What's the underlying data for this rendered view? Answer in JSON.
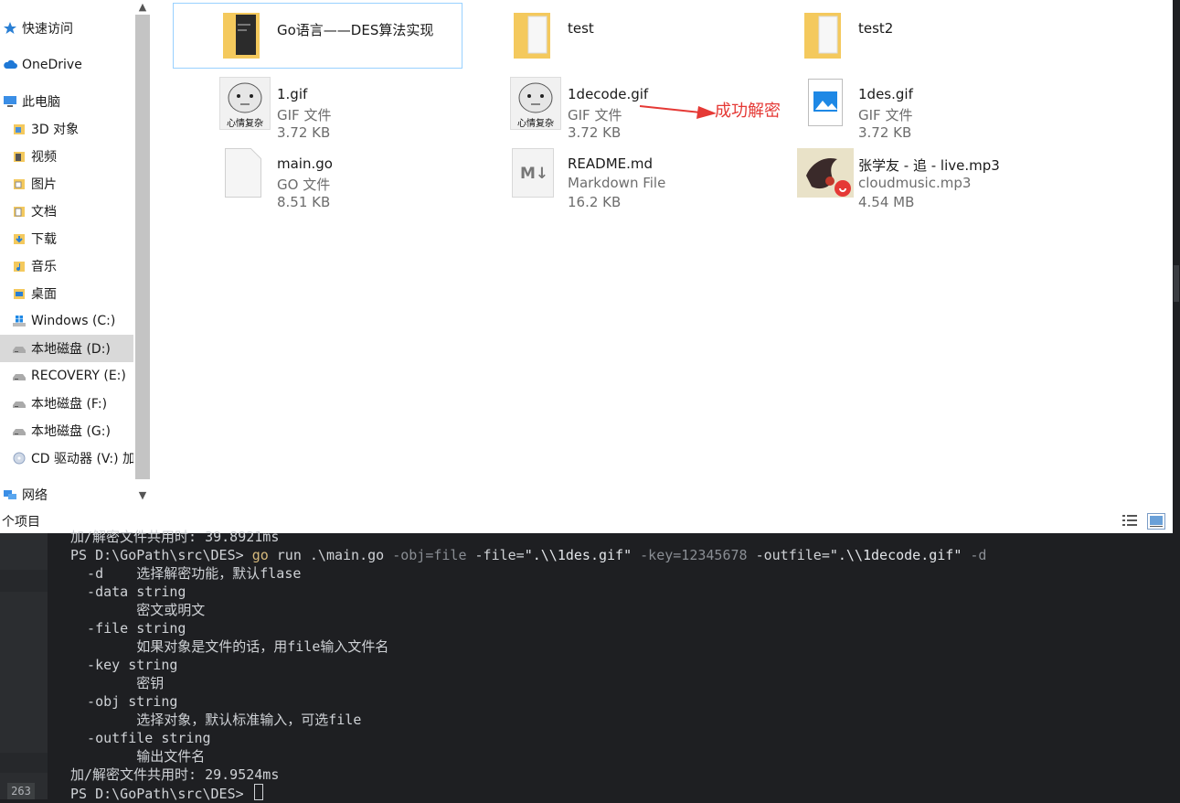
{
  "nav": {
    "items": [
      {
        "label": "快速访问",
        "icon": "star-icon"
      },
      {
        "label": "OneDrive",
        "icon": "cloud-icon"
      },
      {
        "label": "此电脑",
        "icon": "computer-icon"
      },
      {
        "label": "3D 对象",
        "icon": "cube-folder-icon"
      },
      {
        "label": "视频",
        "icon": "video-folder-icon"
      },
      {
        "label": "图片",
        "icon": "picture-folder-icon"
      },
      {
        "label": "文档",
        "icon": "document-folder-icon"
      },
      {
        "label": "下载",
        "icon": "download-folder-icon"
      },
      {
        "label": "音乐",
        "icon": "music-folder-icon"
      },
      {
        "label": "桌面",
        "icon": "desktop-folder-icon"
      },
      {
        "label": "Windows (C:)",
        "icon": "windows-drive-icon"
      },
      {
        "label": "本地磁盘 (D:)",
        "icon": "drive-icon"
      },
      {
        "label": "RECOVERY (E:)",
        "icon": "drive-icon"
      },
      {
        "label": "本地磁盘 (F:)",
        "icon": "drive-icon"
      },
      {
        "label": "本地磁盘 (G:)",
        "icon": "drive-icon"
      },
      {
        "label": "CD 驱动器 (V:) 加",
        "icon": "cd-drive-icon"
      },
      {
        "label": "网络",
        "icon": "network-icon"
      }
    ]
  },
  "files": [
    {
      "name": "Go语言——DES算法实现",
      "type": "",
      "size": "",
      "kind": "folder-dark"
    },
    {
      "name": "test",
      "type": "",
      "size": "",
      "kind": "folder"
    },
    {
      "name": "test2",
      "type": "",
      "size": "",
      "kind": "folder"
    },
    {
      "name": "1.gif",
      "type": "GIF 文件",
      "size": "3.72 KB",
      "kind": "meme"
    },
    {
      "name": "1decode.gif",
      "type": "GIF 文件",
      "size": "3.72 KB",
      "kind": "meme"
    },
    {
      "name": "1des.gif",
      "type": "GIF 文件",
      "size": "3.72 KB",
      "kind": "image-broken"
    },
    {
      "name": "main.go",
      "type": "GO 文件",
      "size": "8.51 KB",
      "kind": "blank"
    },
    {
      "name": "README.md",
      "type": "Markdown File",
      "size": "16.2 KB",
      "kind": "markdown"
    },
    {
      "name": "张学友 - 追 - live.mp3",
      "type": "cloudmusic.mp3",
      "size": "4.54 MB",
      "kind": "music"
    }
  ],
  "meme_caption": "心情复杂",
  "annotation": "成功解密",
  "status": {
    "text": "个项目"
  },
  "terminal": {
    "line_number": "263",
    "lines": [
      {
        "text": "加/解密文件共用时: 39.8921ms"
      },
      {
        "prompt": "PS D:\\GoPath\\src\\DES> ",
        "cmd": "go",
        "rest1": " run .\\main.go ",
        "a1": "-obj=file",
        "rest2": " -file=",
        "s1": "\".\\\\1des.gif\"",
        "a2": " -key=12345678",
        "rest3": " -outfile=",
        "s2": "\".\\\\1decode.gif\"",
        "a3": " -d"
      },
      {
        "text": "  -d    选择解密功能，默认flase"
      },
      {
        "text": "  -data string"
      },
      {
        "text": "        密文或明文"
      },
      {
        "text": "  -file string"
      },
      {
        "text": "        如果对象是文件的话，用file输入文件名"
      },
      {
        "text": "  -key string"
      },
      {
        "text": "        密钥"
      },
      {
        "text": "  -obj string"
      },
      {
        "text": "        选择对象，默认标准输入，可选file"
      },
      {
        "text": "  -outfile string"
      },
      {
        "text": "        输出文件名"
      },
      {
        "text": "加/解密文件共用时: 29.9524ms"
      },
      {
        "text": "PS D:\\GoPath\\src\\DES> "
      }
    ]
  },
  "colors": {
    "annotation": "#e53935",
    "folder": "#f4c95d",
    "accent": "#0078d7",
    "terminal_bg": "#1e1f22",
    "command": "#d7ba7d"
  }
}
